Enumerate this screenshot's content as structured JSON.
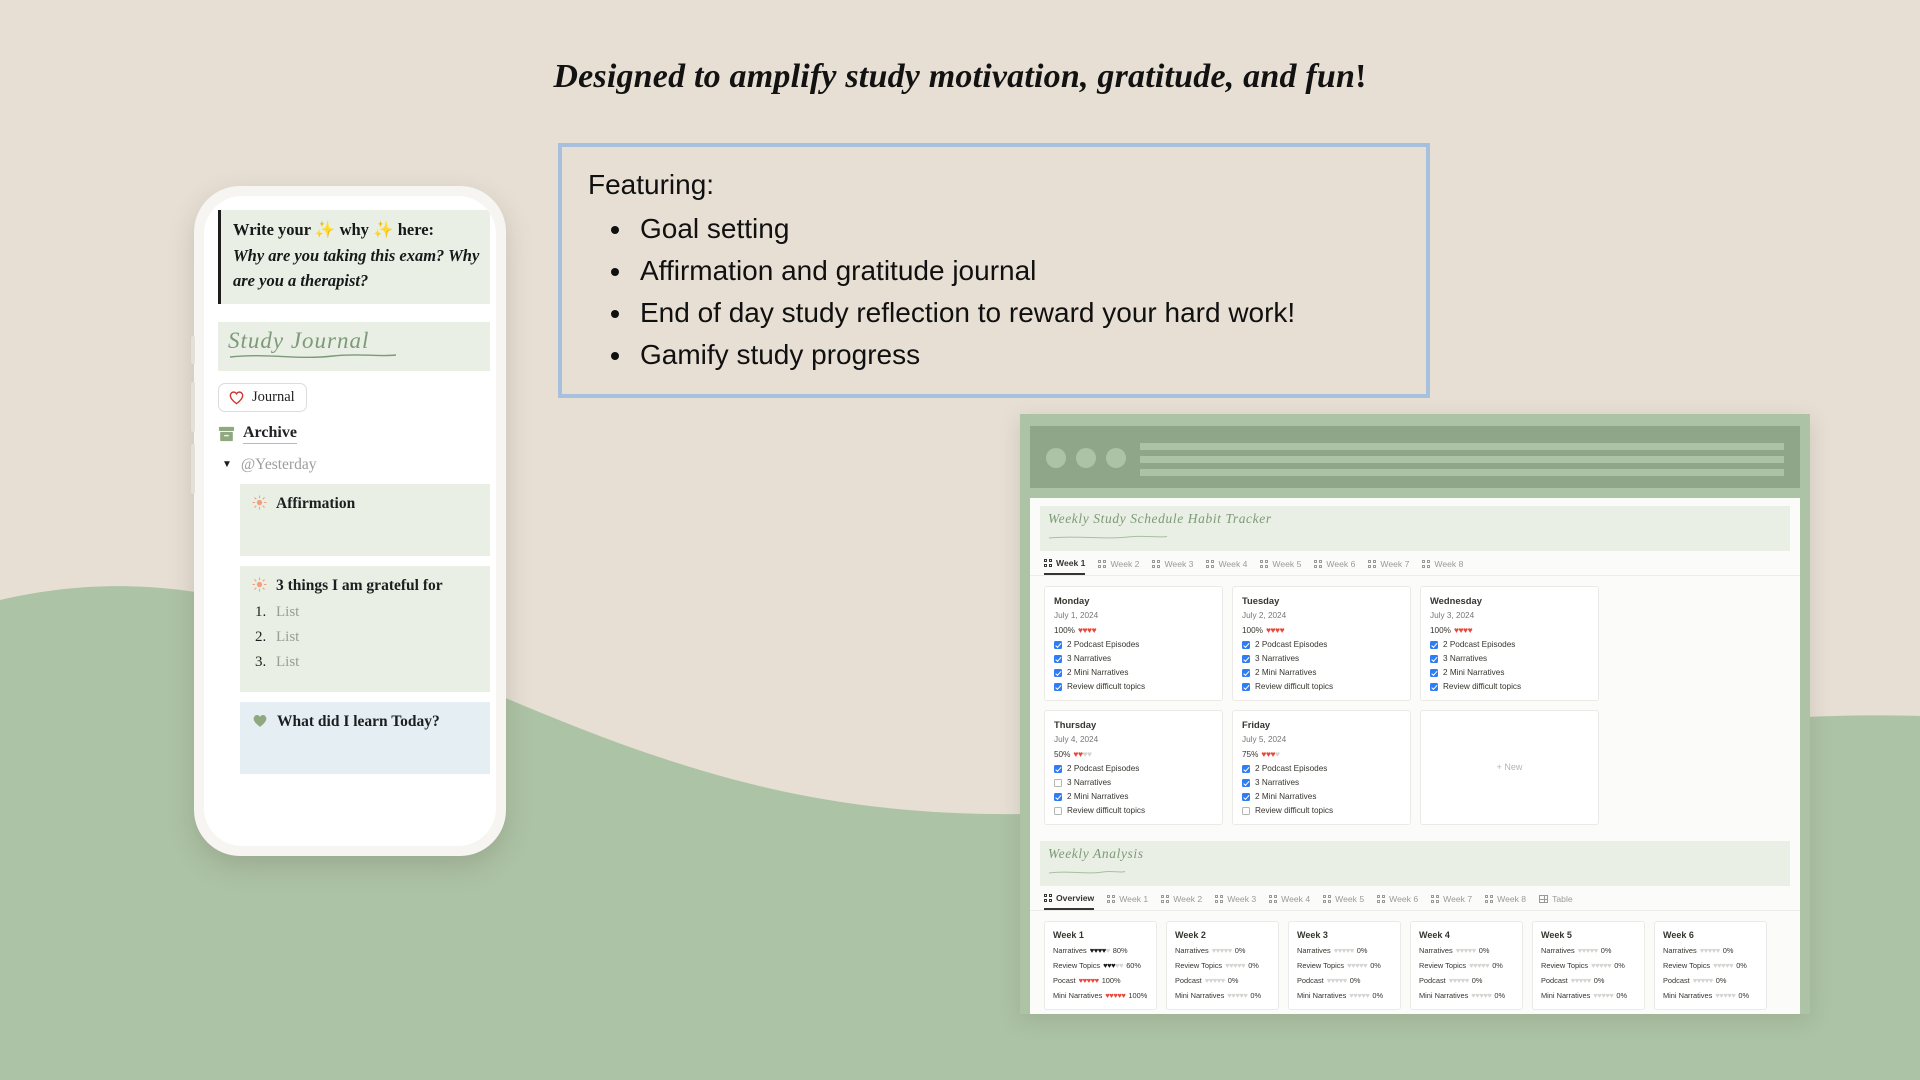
{
  "page": {
    "background_color": "#e7dfd4",
    "wave_color": "#adc3a5",
    "headline_main": "Designed to amplify study motivation, gratitude, and fun",
    "headline_bang": "!"
  },
  "featuring": {
    "title": "Featuring:",
    "border_color": "#a7c0dd",
    "items": [
      "Goal setting",
      "Affirmation and gratitude journal",
      "End of day study reflection to reward your hard work!",
      "Gamify study progress"
    ]
  },
  "phone": {
    "quote": {
      "line1_a": "Write your ",
      "spark1": "✨",
      "line1_b": " why ",
      "spark2": "✨",
      "line1_c": " here:",
      "line2": "Why are you taking this exam? Why are you a therapist?"
    },
    "journal_title": "Study Journal",
    "journal_chip": {
      "label": "Journal",
      "icon": "heart-outline-icon",
      "color": "#d0342c"
    },
    "archive": {
      "label": "Archive",
      "icon": "archive-box-icon"
    },
    "yesterday": {
      "label": "@Yesterday",
      "caret": "▼"
    },
    "cards": [
      {
        "icon": "sun-icon",
        "icon_color": "#f0a07a",
        "title": "Affirmation",
        "theme": "green",
        "list": []
      },
      {
        "icon": "sun-icon",
        "icon_color": "#f0a07a",
        "title": "3 things I am grateful for",
        "theme": "green",
        "list": [
          "List",
          "List",
          "List"
        ]
      },
      {
        "icon": "heart-filled-icon",
        "icon_color": "#8fa87f",
        "title": "What did I learn Today?",
        "theme": "blue",
        "list": []
      }
    ]
  },
  "dashboard": {
    "chrome": {
      "dots": 3
    },
    "habit_tracker": {
      "heading": "Weekly Study Schedule Habit Tracker",
      "tabs": [
        {
          "label": "Week 1",
          "active": true
        },
        {
          "label": "Week 2",
          "active": false
        },
        {
          "label": "Week 3",
          "active": false
        },
        {
          "label": "Week 4",
          "active": false
        },
        {
          "label": "Week 5",
          "active": false
        },
        {
          "label": "Week 6",
          "active": false
        },
        {
          "label": "Week 7",
          "active": false
        },
        {
          "label": "Week 8",
          "active": false
        }
      ],
      "days": [
        {
          "name": "Monday",
          "date": "July 1, 2024",
          "percent": "100%",
          "hearts_filled": 4,
          "hearts_total": 4,
          "tasks": [
            {
              "label": "2 Podcast Episodes",
              "done": true
            },
            {
              "label": "3 Narratives",
              "done": true
            },
            {
              "label": "2 Mini Narratives",
              "done": true
            },
            {
              "label": "Review difficult topics",
              "done": true
            }
          ]
        },
        {
          "name": "Tuesday",
          "date": "July 2, 2024",
          "percent": "100%",
          "hearts_filled": 4,
          "hearts_total": 4,
          "tasks": [
            {
              "label": "2 Podcast Episodes",
              "done": true
            },
            {
              "label": "3 Narratives",
              "done": true
            },
            {
              "label": "2 Mini Narratives",
              "done": true
            },
            {
              "label": "Review difficult topics",
              "done": true
            }
          ]
        },
        {
          "name": "Wednesday",
          "date": "July 3, 2024",
          "percent": "100%",
          "hearts_filled": 4,
          "hearts_total": 4,
          "tasks": [
            {
              "label": "2 Podcast Episodes",
              "done": true
            },
            {
              "label": "3 Narratives",
              "done": true
            },
            {
              "label": "2 Mini Narratives",
              "done": true
            },
            {
              "label": "Review difficult topics",
              "done": true
            }
          ]
        },
        {
          "name": "Thursday",
          "date": "July 4, 2024",
          "percent": "50%",
          "hearts_filled": 2,
          "hearts_total": 4,
          "tasks": [
            {
              "label": "2 Podcast Episodes",
              "done": true
            },
            {
              "label": "3 Narratives",
              "done": false
            },
            {
              "label": "2 Mini Narratives",
              "done": true
            },
            {
              "label": "Review difficult topics",
              "done": false
            }
          ]
        },
        {
          "name": "Friday",
          "date": "July 5, 2024",
          "percent": "75%",
          "hearts_filled": 3,
          "hearts_total": 4,
          "tasks": [
            {
              "label": "2 Podcast Episodes",
              "done": true
            },
            {
              "label": "3 Narratives",
              "done": true
            },
            {
              "label": "2 Mini Narratives",
              "done": true
            },
            {
              "label": "Review difficult topics",
              "done": false
            }
          ]
        }
      ],
      "new_label": "+ New"
    },
    "weekly_analysis": {
      "heading": "Weekly Analysis",
      "tabs": [
        {
          "label": "Overview",
          "active": true,
          "icon": "grid-icon"
        },
        {
          "label": "Week 1",
          "active": false,
          "icon": "grid-icon"
        },
        {
          "label": "Week 2",
          "active": false,
          "icon": "grid-icon"
        },
        {
          "label": "Week 3",
          "active": false,
          "icon": "grid-icon"
        },
        {
          "label": "Week 4",
          "active": false,
          "icon": "grid-icon"
        },
        {
          "label": "Week 5",
          "active": false,
          "icon": "grid-icon"
        },
        {
          "label": "Week 6",
          "active": false,
          "icon": "grid-icon"
        },
        {
          "label": "Week 7",
          "active": false,
          "icon": "grid-icon"
        },
        {
          "label": "Week 8",
          "active": false,
          "icon": "grid-icon"
        },
        {
          "label": "Table",
          "active": false,
          "icon": "table-icon"
        }
      ],
      "weeks": [
        {
          "name": "Week 1",
          "metrics": [
            {
              "label": "Narratives",
              "filled": 4,
              "total": 5,
              "pct": "80%",
              "style": "dark"
            },
            {
              "label": "Review Topics",
              "filled": 3,
              "total": 5,
              "pct": "60%",
              "style": "dark"
            },
            {
              "label": "Pocast",
              "filled": 5,
              "total": 5,
              "pct": "100%",
              "style": "red"
            },
            {
              "label": "Mini Narratives",
              "filled": 5,
              "total": 5,
              "pct": "100%",
              "style": "red"
            }
          ]
        },
        {
          "name": "Week 2",
          "metrics": [
            {
              "label": "Narratives",
              "filled": 0,
              "total": 5,
              "pct": "0%",
              "style": "dark"
            },
            {
              "label": "Review Topics",
              "filled": 0,
              "total": 5,
              "pct": "0%",
              "style": "dark"
            },
            {
              "label": "Podcast",
              "filled": 0,
              "total": 5,
              "pct": "0%",
              "style": "dark"
            },
            {
              "label": "Mini Narratives",
              "filled": 0,
              "total": 5,
              "pct": "0%",
              "style": "dark"
            }
          ]
        },
        {
          "name": "Week 3",
          "metrics": [
            {
              "label": "Narratives",
              "filled": 0,
              "total": 5,
              "pct": "0%",
              "style": "dark"
            },
            {
              "label": "Review Topics",
              "filled": 0,
              "total": 5,
              "pct": "0%",
              "style": "dark"
            },
            {
              "label": "Podcast",
              "filled": 0,
              "total": 5,
              "pct": "0%",
              "style": "dark"
            },
            {
              "label": "Mini Narratives",
              "filled": 0,
              "total": 5,
              "pct": "0%",
              "style": "dark"
            }
          ]
        },
        {
          "name": "Week 4",
          "metrics": [
            {
              "label": "Narratives",
              "filled": 0,
              "total": 5,
              "pct": "0%",
              "style": "dark"
            },
            {
              "label": "Review Topics",
              "filled": 0,
              "total": 5,
              "pct": "0%",
              "style": "dark"
            },
            {
              "label": "Podcast",
              "filled": 0,
              "total": 5,
              "pct": "0%",
              "style": "dark"
            },
            {
              "label": "Mini Narratives",
              "filled": 0,
              "total": 5,
              "pct": "0%",
              "style": "dark"
            }
          ]
        },
        {
          "name": "Week 5",
          "metrics": [
            {
              "label": "Narratives",
              "filled": 0,
              "total": 5,
              "pct": "0%",
              "style": "dark"
            },
            {
              "label": "Review Topics",
              "filled": 0,
              "total": 5,
              "pct": "0%",
              "style": "dark"
            },
            {
              "label": "Podcast",
              "filled": 0,
              "total": 5,
              "pct": "0%",
              "style": "dark"
            },
            {
              "label": "Mini Narratives",
              "filled": 0,
              "total": 5,
              "pct": "0%",
              "style": "dark"
            }
          ]
        },
        {
          "name": "Week 6",
          "metrics": [
            {
              "label": "Narratives",
              "filled": 0,
              "total": 5,
              "pct": "0%",
              "style": "dark"
            },
            {
              "label": "Review Topics",
              "filled": 0,
              "total": 5,
              "pct": "0%",
              "style": "dark"
            },
            {
              "label": "Podcast",
              "filled": 0,
              "total": 5,
              "pct": "0%",
              "style": "dark"
            },
            {
              "label": "Mini Narratives",
              "filled": 0,
              "total": 5,
              "pct": "0%",
              "style": "dark"
            }
          ]
        }
      ]
    }
  }
}
